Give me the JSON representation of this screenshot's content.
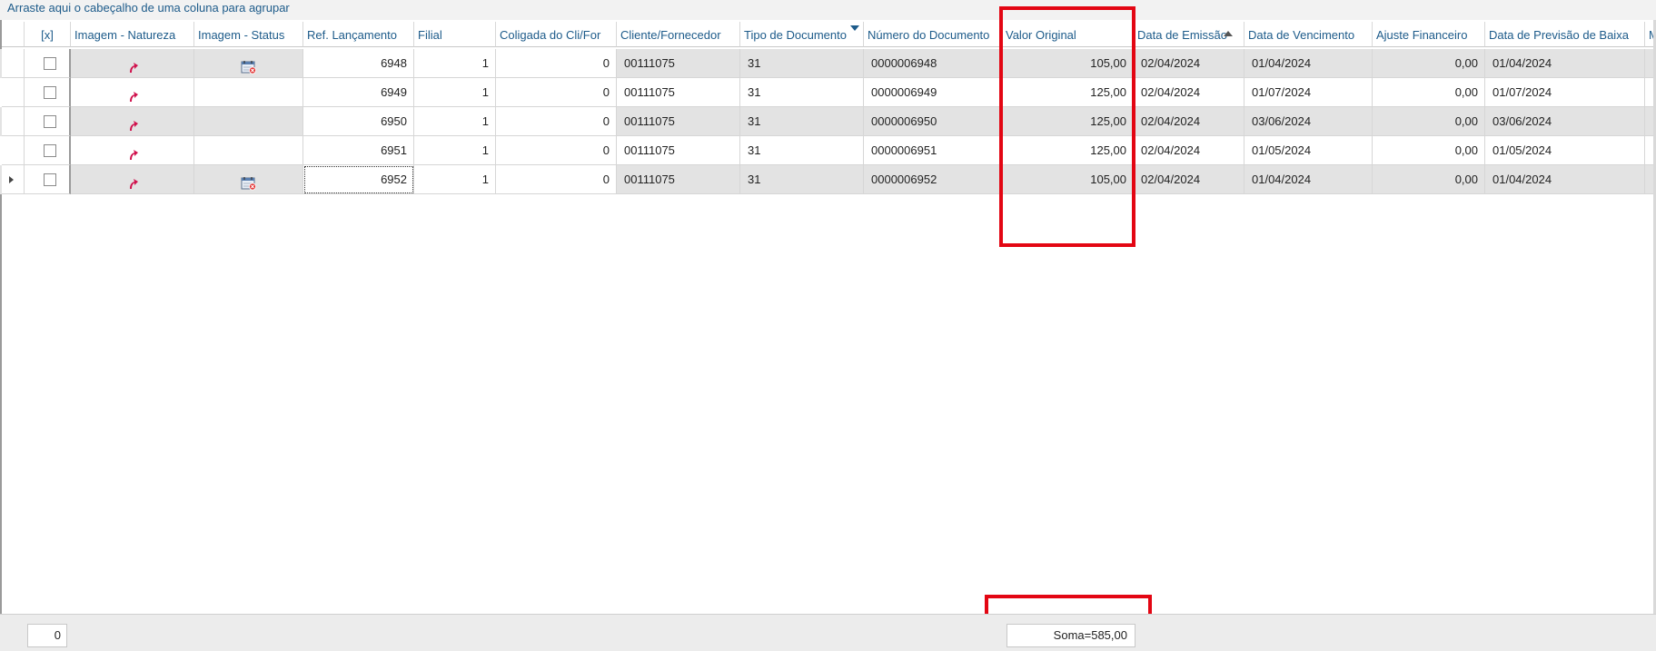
{
  "group_panel": {
    "hint": "Arraste aqui o cabeçalho de uma coluna para agrupar"
  },
  "columns": [
    {
      "key": "sel",
      "label": "[x]"
    },
    {
      "key": "natureza",
      "label": "Imagem - Natureza"
    },
    {
      "key": "status",
      "label": "Imagem - Status"
    },
    {
      "key": "ref",
      "label": "Ref. Lançamento"
    },
    {
      "key": "filial",
      "label": "Filial"
    },
    {
      "key": "coligada",
      "label": "Coligada do Cli/For"
    },
    {
      "key": "cliente",
      "label": "Cliente/Fornecedor"
    },
    {
      "key": "tipo",
      "label": "Tipo de Documento"
    },
    {
      "key": "numero",
      "label": "Número do Documento"
    },
    {
      "key": "valor",
      "label": "Valor Original"
    },
    {
      "key": "emissao",
      "label": "Data de Emissão"
    },
    {
      "key": "vencimento",
      "label": "Data de Vencimento"
    },
    {
      "key": "ajuste",
      "label": "Ajuste Financeiro"
    },
    {
      "key": "previsao",
      "label": "Data de Previsão de Baixa"
    },
    {
      "key": "extra",
      "label": "M"
    }
  ],
  "rows": [
    {
      "checked": false,
      "natureza_icon": "red-arrow-up-icon",
      "status_icon": "calendar-icon",
      "ref": "6948",
      "filial": "1",
      "coligada": "0",
      "cliente": "00111075",
      "tipo": "31",
      "numero": "0000006948",
      "valor": "105,00",
      "emissao": "02/04/2024",
      "vencimento": "01/04/2024",
      "ajuste": "0,00",
      "previsao": "01/04/2024"
    },
    {
      "checked": false,
      "natureza_icon": "red-arrow-up-icon",
      "status_icon": "",
      "ref": "6949",
      "filial": "1",
      "coligada": "0",
      "cliente": "00111075",
      "tipo": "31",
      "numero": "0000006949",
      "valor": "125,00",
      "emissao": "02/04/2024",
      "vencimento": "01/07/2024",
      "ajuste": "0,00",
      "previsao": "01/07/2024"
    },
    {
      "checked": false,
      "natureza_icon": "red-arrow-up-icon",
      "status_icon": "",
      "ref": "6950",
      "filial": "1",
      "coligada": "0",
      "cliente": "00111075",
      "tipo": "31",
      "numero": "0000006950",
      "valor": "125,00",
      "emissao": "02/04/2024",
      "vencimento": "03/06/2024",
      "ajuste": "0,00",
      "previsao": "03/06/2024"
    },
    {
      "checked": false,
      "natureza_icon": "red-arrow-up-icon",
      "status_icon": "",
      "ref": "6951",
      "filial": "1",
      "coligada": "0",
      "cliente": "00111075",
      "tipo": "31",
      "numero": "0000006951",
      "valor": "125,00",
      "emissao": "02/04/2024",
      "vencimento": "01/05/2024",
      "ajuste": "0,00",
      "previsao": "01/05/2024"
    },
    {
      "checked": false,
      "natureza_icon": "red-arrow-up-icon",
      "status_icon": "calendar-icon",
      "ref": "6952",
      "filial": "1",
      "coligada": "0",
      "cliente": "00111075",
      "tipo": "31",
      "numero": "0000006952",
      "valor": "105,00",
      "emissao": "02/04/2024",
      "vencimento": "01/04/2024",
      "ajuste": "0,00",
      "previsao": "01/04/2024",
      "current": true
    }
  ],
  "footer": {
    "record_count": "0",
    "sum_text": "Soma=585,00"
  },
  "colors": {
    "header_text": "#1d5b8a",
    "highlight": "#e30613",
    "odd_row": "#e3e3e3",
    "icon_red": "#d0104c"
  }
}
